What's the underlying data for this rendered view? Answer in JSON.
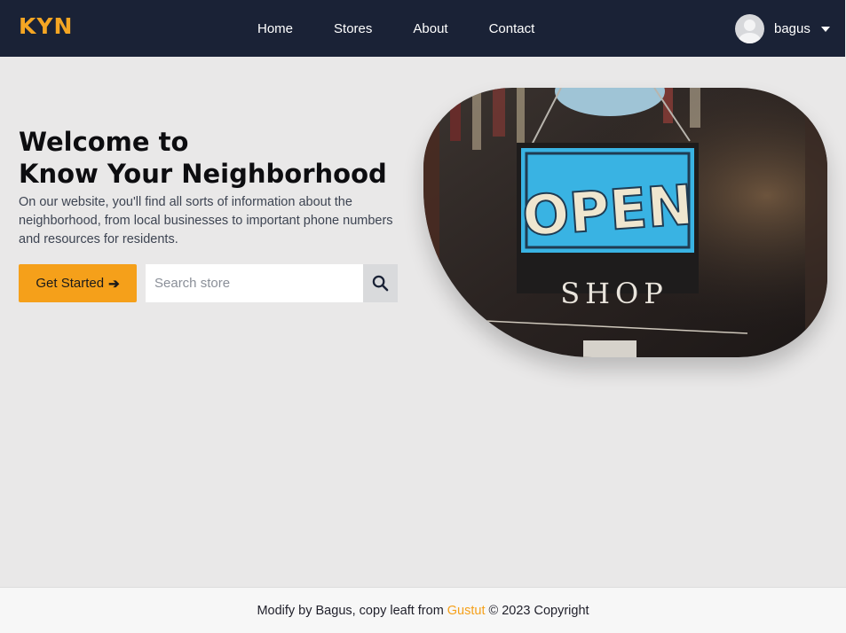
{
  "brand": "KYN",
  "nav": {
    "links": [
      "Home",
      "Stores",
      "About",
      "Contact"
    ]
  },
  "user": {
    "name": "bagus"
  },
  "hero": {
    "title_line1": "Welcome to",
    "title_line2": "Know Your Neighborhood",
    "description": "On our website, you'll find all sorts of information about the neighborhood, from local businesses to important phone numbers and resources for residents.",
    "cta_label": "Get Started",
    "search_placeholder": "Search store",
    "sign_text_1": "OPEN",
    "sign_text_2": "SHOP"
  },
  "footer": {
    "prefix": "Modify by Bagus, copy leaft from",
    "link": "Gustut",
    "suffix": "© 2023 Copyright"
  },
  "colors": {
    "navbar": "#1a2236",
    "accent": "#f5a01a",
    "background": "#e9e8e8"
  },
  "icons": {
    "cta": "arrow-right-icon",
    "search": "search-icon",
    "user_menu": "caret-down-icon",
    "avatar": "user-avatar-icon"
  }
}
